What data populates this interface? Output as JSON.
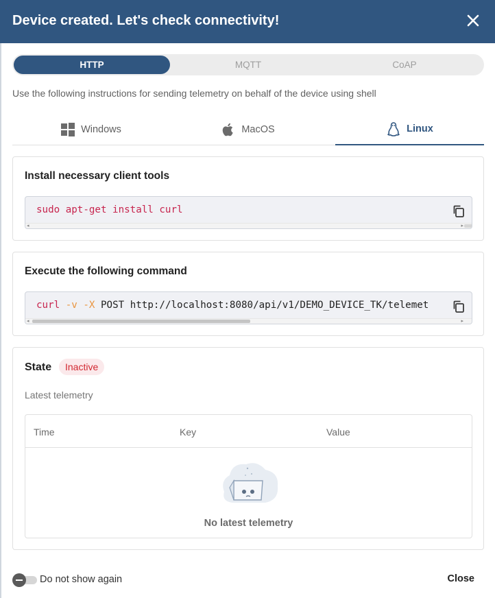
{
  "dialog": {
    "title": "Device created. Let's check connectivity!",
    "close_icon": "close-icon"
  },
  "protocols": {
    "items": [
      {
        "label": "HTTP",
        "active": true
      },
      {
        "label": "MQTT",
        "active": false
      },
      {
        "label": "CoAP",
        "active": false
      }
    ]
  },
  "intro_text": "Use the following instructions for sending telemetry on behalf of the device using shell",
  "os_tabs": {
    "items": [
      {
        "label": "Windows",
        "icon": "windows-icon",
        "active": false
      },
      {
        "label": "MacOS",
        "icon": "apple-icon",
        "active": false
      },
      {
        "label": "Linux",
        "icon": "linux-icon",
        "active": true
      }
    ]
  },
  "install_card": {
    "title": "Install necessary client tools",
    "command": "sudo apt-get install curl",
    "copy_icon": "copy-icon"
  },
  "execute_card": {
    "title": "Execute the following command",
    "cmd_curl": "curl",
    "cmd_flag_v": "-v",
    "cmd_flag_x": "-X",
    "cmd_rest": "POST http://localhost:8080/api/v1/DEMO_DEVICE_TK/telemet",
    "copy_icon": "copy-icon"
  },
  "state_card": {
    "state_label": "State",
    "status_badge": "Inactive",
    "latest_label": "Latest telemetry",
    "columns": [
      "Time",
      "Key",
      "Value"
    ],
    "empty_text": "No latest telemetry"
  },
  "footer": {
    "toggle_label": "Do not show again",
    "close_label": "Close"
  },
  "colors": {
    "primary": "#305680",
    "badge_bg": "#fbe9eb",
    "badge_text": "#d12730"
  }
}
